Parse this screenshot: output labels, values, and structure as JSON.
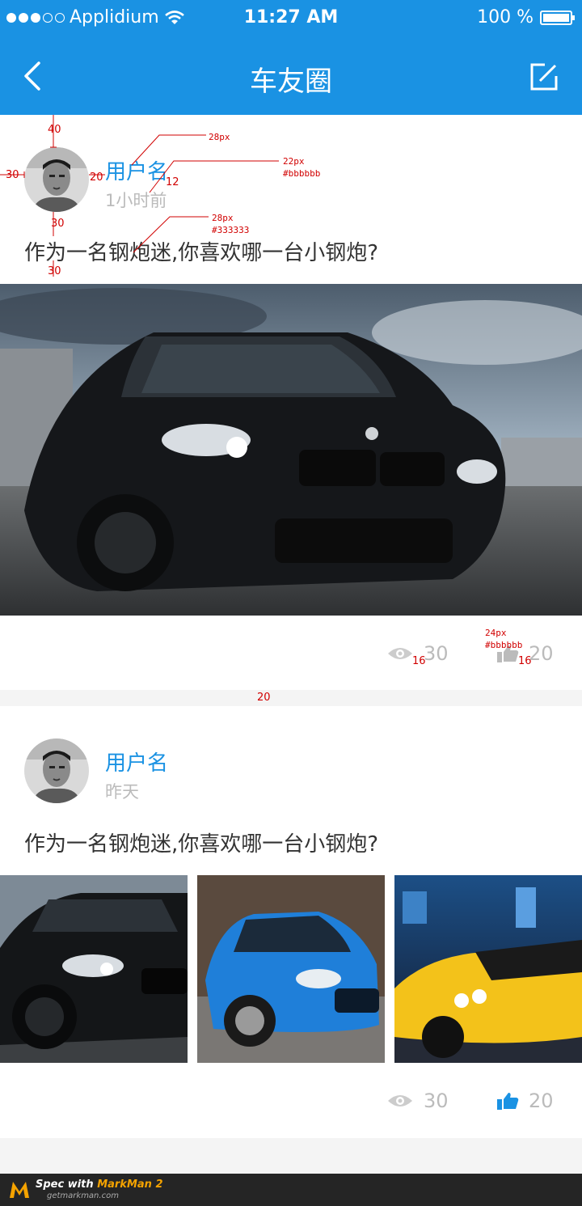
{
  "status": {
    "carrier": "Applidium",
    "time": "11:27 AM",
    "battery": "100 %"
  },
  "nav": {
    "title": "车友圈"
  },
  "posts": [
    {
      "username": "用户名",
      "time": "1小时前",
      "text": "作为一名钢炮迷,你喜欢哪一台小钢炮?",
      "views": "30",
      "likes": "20"
    },
    {
      "username": "用户名",
      "time": "昨天",
      "text": "作为一名钢炮迷,你喜欢哪一台小钢炮?",
      "views": "30",
      "likes": "20"
    }
  ],
  "annotations": {
    "name_font": "28px",
    "time_font": "22px",
    "time_color": "#bbbbbb",
    "text_font": "28px",
    "text_color": "#333333",
    "stat_font": "24px",
    "stat_color": "#bbbbbb",
    "top_gap": "40",
    "left_gap": "30",
    "avatar_gap": "20",
    "line_gap": "12",
    "below_avatar": "30",
    "below_text": "30",
    "icon_gap_1": "16",
    "icon_gap_2": "16",
    "card_gap": "20"
  },
  "footer": {
    "spec_prefix": "Spec with ",
    "spec_brand": "MarkMan 2",
    "site": "getmarkman.com"
  },
  "colors": {
    "primary": "#1a92e3",
    "text": "#333333",
    "muted": "#bbbbbb"
  }
}
